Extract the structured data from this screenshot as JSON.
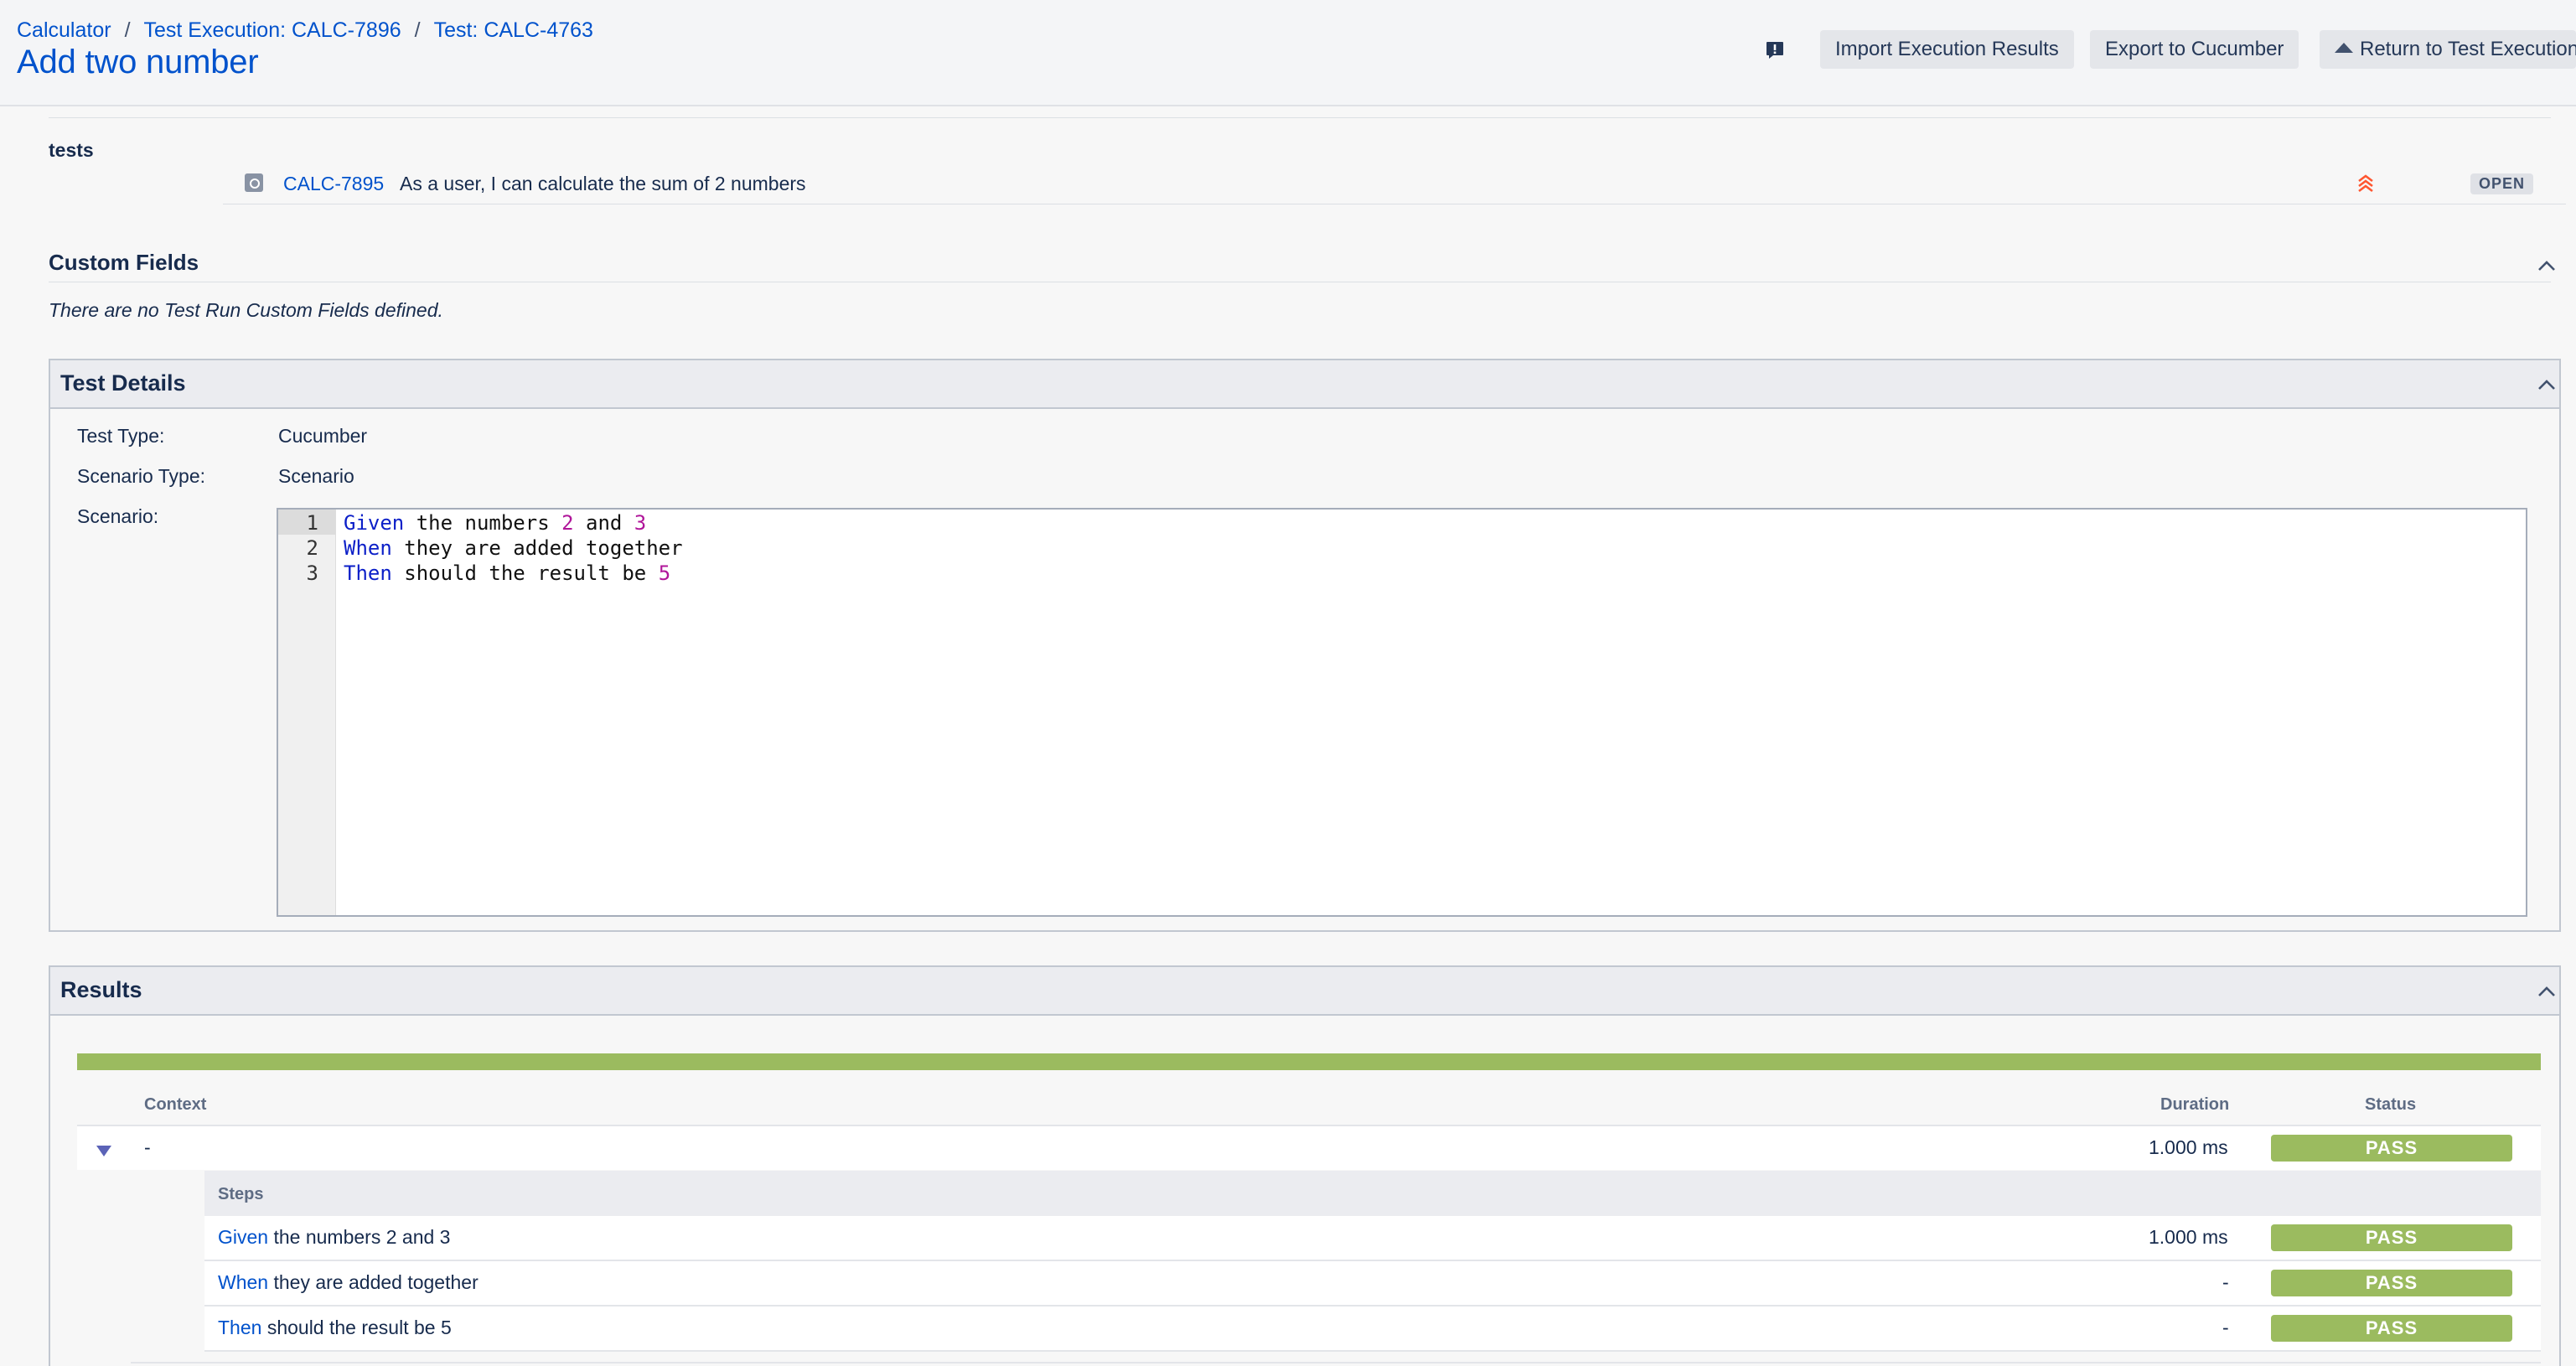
{
  "breadcrumbs": [
    {
      "label": "Calculator"
    },
    {
      "label": "Test Execution: CALC-7896"
    },
    {
      "label": "Test: CALC-4763"
    }
  ],
  "breadcrumb_separator": "/",
  "page_title": "Add two number",
  "header_buttons": {
    "import": "Import Execution Results",
    "export": "Export to Cucumber",
    "return": "Return to Test Execution"
  },
  "tests_section": {
    "label": "tests",
    "issue_key": "CALC-7895",
    "issue_summary": "As a user, I can calculate the sum of 2 numbers",
    "status": "OPEN"
  },
  "custom_fields": {
    "title": "Custom Fields",
    "empty_message": "There are no Test Run Custom Fields defined."
  },
  "test_details": {
    "title": "Test Details",
    "test_type_label": "Test Type:",
    "test_type_value": "Cucumber",
    "scenario_type_label": "Scenario Type:",
    "scenario_type_value": "Scenario",
    "scenario_label": "Scenario:",
    "scenario_lines": [
      {
        "num": "1",
        "keyword": "Given",
        "parts": [
          " the numbers ",
          "2",
          " and ",
          "3"
        ]
      },
      {
        "num": "2",
        "keyword": "When",
        "parts": [
          " they are added together"
        ]
      },
      {
        "num": "3",
        "keyword": "Then",
        "parts": [
          " should the result be ",
          "5"
        ]
      }
    ]
  },
  "results": {
    "title": "Results",
    "progress_pass_fraction": 1.0,
    "columns": {
      "context": "Context",
      "duration": "Duration",
      "status": "Status"
    },
    "context_row": {
      "context": "-",
      "duration": "1.000 ms",
      "status": "PASS"
    },
    "steps_header": "Steps",
    "steps": [
      {
        "keyword": "Given",
        "text": " the numbers 2 and 3",
        "duration": "1.000 ms",
        "status": "PASS"
      },
      {
        "keyword": "When",
        "text": " they are added together",
        "duration": "-",
        "status": "PASS"
      },
      {
        "keyword": "Then",
        "text": " should the result be 5",
        "duration": "-",
        "status": "PASS"
      }
    ]
  },
  "colors": {
    "link": "#0052cc",
    "pass": "#9bbb5f",
    "keyword": "#0b1fc8",
    "number": "#b0169a",
    "priority": "#ff5630"
  },
  "icons": [
    "feedback-icon",
    "issue-type-icon",
    "priority-highest-icon",
    "chevron-up-icon",
    "expand-triangle-icon"
  ]
}
